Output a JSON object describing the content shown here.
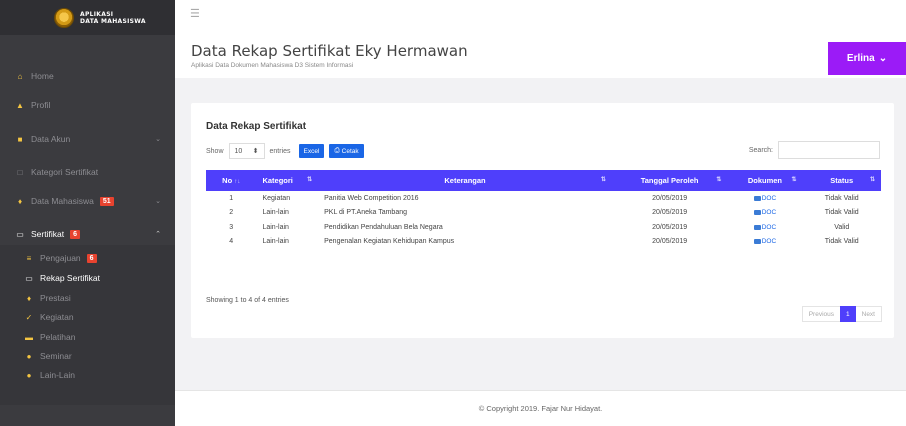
{
  "brand": {
    "line1": "APLIKASI",
    "line2": "DATA MAHASISWA"
  },
  "sidebar": {
    "home": {
      "label": "Home",
      "icon": "home-icon"
    },
    "profil": {
      "label": "Profil",
      "icon": "user-icon"
    },
    "data_akun": {
      "label": "Data Akun",
      "icon": "database-icon"
    },
    "kategori": {
      "label": "Kategori Sertifikat",
      "icon": "square-icon"
    },
    "data_mahasiswa": {
      "label": "Data Mahasiswa",
      "badge": "51",
      "icon": "graduation-icon"
    },
    "sertifikat": {
      "label": "Sertifikat",
      "badge": "6",
      "icon": "document-icon"
    },
    "sub": [
      {
        "label": "Pengajuan",
        "badge": "6",
        "icon": "list-icon"
      },
      {
        "label": "Rekap Sertifikat",
        "icon": "document-icon"
      },
      {
        "label": "Prestasi",
        "icon": "trophy-icon"
      },
      {
        "label": "Kegiatan",
        "icon": "check-icon"
      },
      {
        "label": "Pelatihan",
        "icon": "graduation-icon"
      },
      {
        "label": "Seminar",
        "icon": "circle-icon"
      },
      {
        "label": "Lain-Lain",
        "icon": "info-icon"
      }
    ]
  },
  "header": {
    "title": "Data Rekap Sertifikat Eky Hermawan",
    "subtitle": "Aplikasi Data Dokumen Mahasiswa D3 Sistem Informasi",
    "user": "Erlina"
  },
  "card": {
    "title": "Data Rekap Sertifikat",
    "show_label": "Show",
    "entries_value": "10",
    "entries_label": "entries",
    "excel_label": "Excel",
    "cetak_label": "Cetak",
    "search_label": "Search:",
    "columns": [
      "No",
      "Kategori",
      "Keterangan",
      "Tanggal Peroleh",
      "Dokumen",
      "Status"
    ],
    "rows": [
      {
        "no": "1",
        "kategori": "Kegiatan",
        "keterangan": "Panitia Web Competition 2016",
        "tanggal": "20/05/2019",
        "dokumen": "DOC",
        "status": "Tidak Valid"
      },
      {
        "no": "2",
        "kategori": "Lain-lain",
        "keterangan": "PKL di PT.Aneka Tambang",
        "tanggal": "20/05/2019",
        "dokumen": "DOC",
        "status": "Tidak Valid"
      },
      {
        "no": "3",
        "kategori": "Lain-lain",
        "keterangan": "Pendidikan Pendahuluan Bela Negara",
        "tanggal": "20/05/2019",
        "dokumen": "DOC",
        "status": "Valid"
      },
      {
        "no": "4",
        "kategori": "Lain-lain",
        "keterangan": "Pengenalan Kegiatan Kehidupan Kampus",
        "tanggal": "20/05/2019",
        "dokumen": "DOC",
        "status": "Tidak Valid"
      }
    ],
    "showing": "Showing 1 to 4 of 4 entries",
    "pagination": {
      "previous": "Previous",
      "page": "1",
      "next": "Next"
    }
  },
  "footer": {
    "copyright": "© Copyright 2019. Fajar Nur Hidayat."
  },
  "colors": {
    "accent": "#4f3ffb",
    "user_button": "#9b1bf7",
    "badge": "#e8432f",
    "sidebar": "#3b3b3f"
  }
}
